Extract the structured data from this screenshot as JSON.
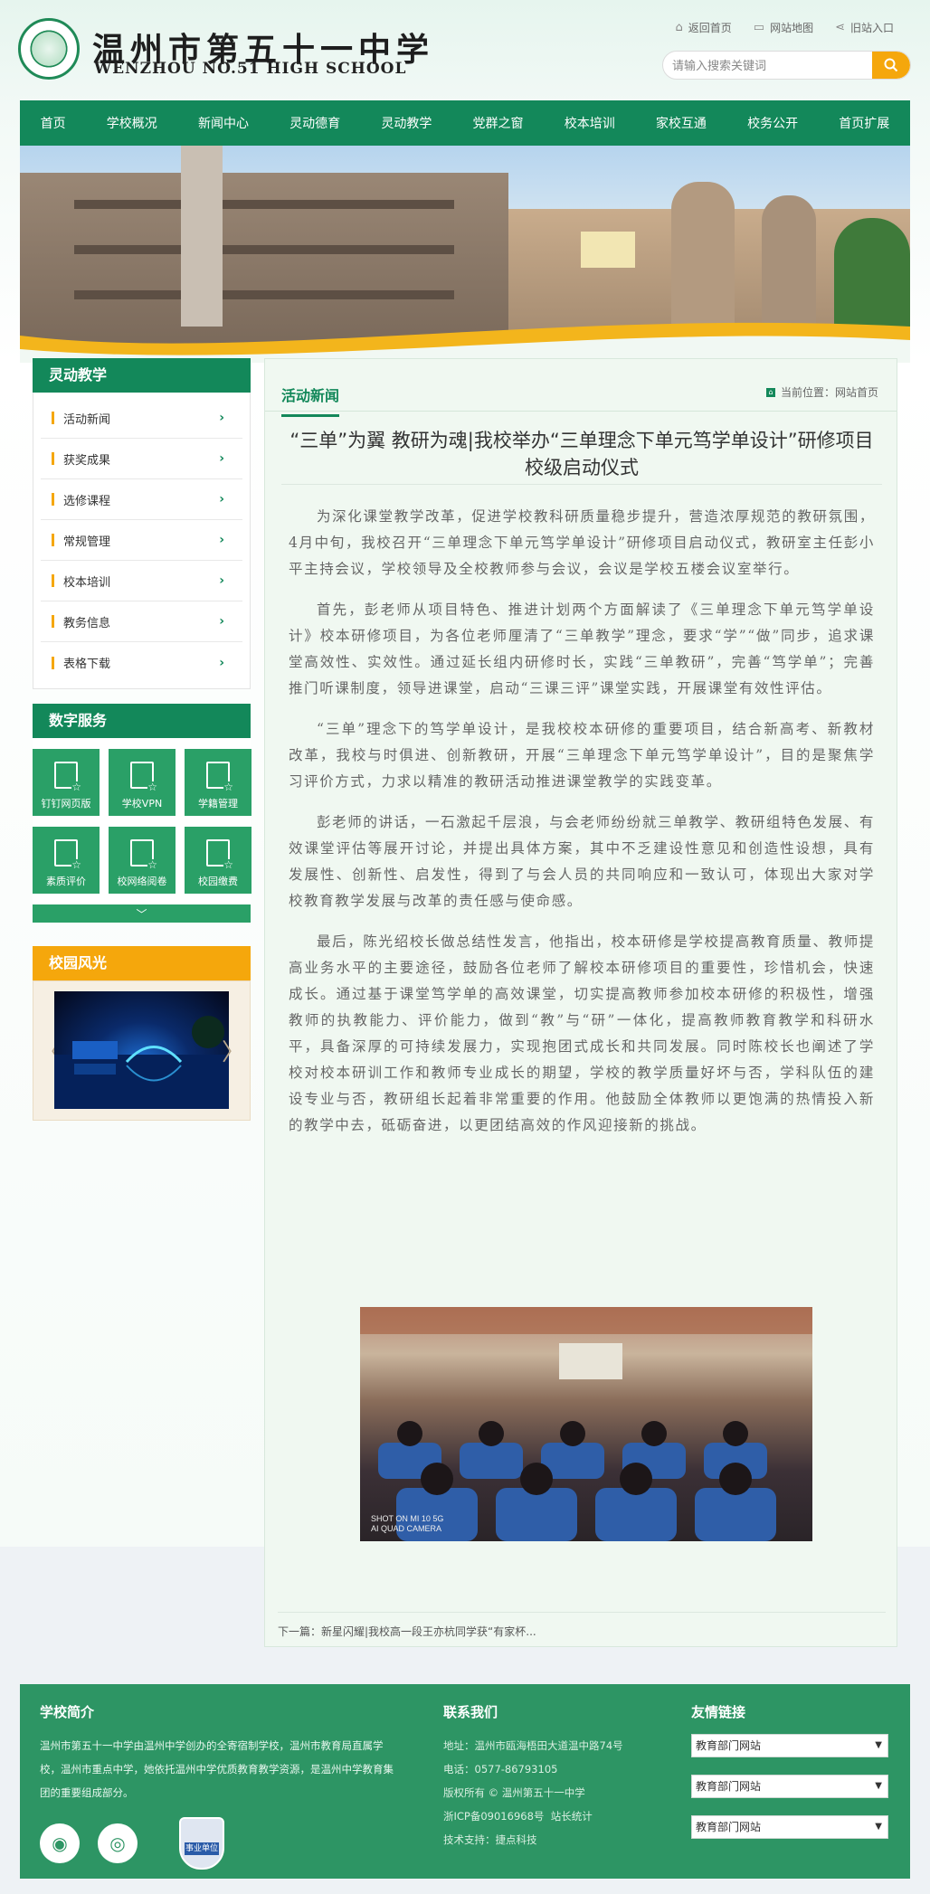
{
  "header": {
    "logo_cn": "温州市第五十一中学",
    "logo_en": "WENZHOU NO.51 HIGH SCHOOL",
    "links": [
      "返回首页",
      "网站地图",
      "旧站入口"
    ],
    "search_placeholder": "请输入搜索关键词"
  },
  "nav": [
    "首页",
    "学校概况",
    "新闻中心",
    "灵动德育",
    "灵动教学",
    "党群之窗",
    "校本培训",
    "家校互通",
    "校务公开",
    "首页扩展"
  ],
  "sidebar": {
    "menu_title": "灵动教学",
    "menu": [
      "活动新闻",
      "获奖成果",
      "选修课程",
      "常规管理",
      "校本培训",
      "教务信息",
      "表格下载"
    ],
    "services_title": "数字服务",
    "services": [
      "钉钉网页版",
      "学校VPN",
      "学籍管理",
      "素质评价",
      "校网络阅卷",
      "校园缴费"
    ],
    "campus_title": "校园风光"
  },
  "main": {
    "section_title": "活动新闻",
    "location_label": "当前位置：网站首页",
    "article_title": "“三单”为翼 教研为魂|我校举办“三单理念下单元笃学单设计”研修项目校级启动仪式",
    "paragraphs": [
      "为深化课堂教学改革，促进学校教科研质量稳步提升，营造浓厚规范的教研氛围，4月中旬，我校召开“三单理念下单元笃学单设计”研修项目启动仪式，教研室主任彭小平主持会议，学校领导及全校教师参与会议，会议是学校五楼会议室举行。",
      "首先，彭老师从项目特色、推进计划两个方面解读了《三单理念下单元笃学单设计》校本研修项目，为各位老师厘清了“三单教学”理念，要求“学”“做”同步，追求课堂高效性、实效性。通过延长组内研修时长，实践“三单教研”，完善“笃学单”；完善推门听课制度，领导进课堂，启动“三课三评”课堂实践，开展课堂有效性评估。",
      "“三单”理念下的笃学单设计，是我校校本研修的重要项目，结合新高考、新教材改革，我校与时俱进、创新教研，开展“三单理念下单元笃学单设计”，目的是聚焦学习评价方式，力求以精准的教研活动推进课堂教学的实践变革。",
      "彭老师的讲话，一石激起千层浪，与会老师纷纷就三单教学、教研组特色发展、有效课堂评估等展开讨论，并提出具体方案，其中不乏建设性意见和创造性设想，具有发展性、创新性、启发性，得到了与会人员的共同响应和一致认可，体现出大家对学校教育教学发展与改革的责任感与使命感。",
      "最后，陈光绍校长做总结性发言，他指出，校本研修是学校提高教育质量、教师提高业务水平的主要途径，鼓励各位老师了解校本研修项目的重要性，珍惜机会，快速成长。通过基于课堂笃学单的高效课堂，切实提高教师参加校本研修的积极性，增强教师的执教能力、评价能力，做到“教”与“研”一体化，提高教师教育教学和科研水平，具备深厚的可持续发展力，实现抱团式成长和共同发展。同时陈校长也阐述了学校对校本研训工作和教师专业成长的期望，学校的教学质量好坏与否，学科队伍的建设专业与否，教研组长起着非常重要的作用。他鼓励全体教师以更饱满的热情投入新的教学中去，砥砺奋进，以更团结高效的作风迎接新的挑战。"
    ],
    "photo_watermark_line1": "SHOT ON MI 10 5G",
    "photo_watermark_line2": "AI QUAD CAMERA",
    "next_link": "下一篇：新星闪耀|我校高一段王亦杭同学获“有家杯..."
  },
  "footer": {
    "intro_title": "学校简介",
    "intro_text": "温州市第五十一中学由温州中学创办的全寄宿制学校，温州市教育局直属学校，温州市重点中学，她依托温州中学优质教育教学资源，是温州中学教育集团的重要组成部分。",
    "badge_label": "事业单位",
    "contact_title": "联系我们",
    "address": "地址：温州市瓯海梧田大道温中路74号",
    "phone": "电话：0577-86793105",
    "copyright": "版权所有 © 温州第五十一中学",
    "icp": "浙ICP备09016968号",
    "stats": "站长统计",
    "support": "技术支持：捷点科技",
    "links_title": "友情链接",
    "links": [
      "教育部门网站",
      "教育部门网站",
      "教育部门网站"
    ]
  },
  "colors": {
    "primary_green": "#13885a",
    "accent_orange": "#f5a70c"
  }
}
